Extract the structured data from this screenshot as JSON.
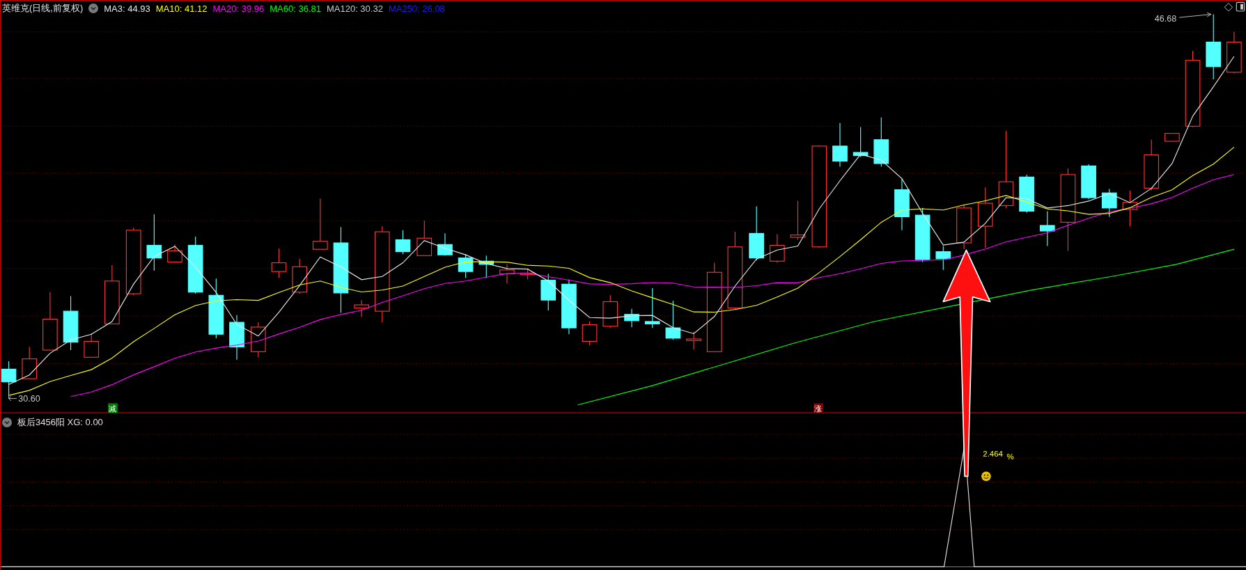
{
  "main_pane": {
    "title": "英维克(日线,前复权)",
    "ma_legend": [
      {
        "label": "MA3: 44.93",
        "color": "#e8e8e8"
      },
      {
        "label": "MA10: 41.12",
        "color": "#ffff00"
      },
      {
        "label": "MA20: 39.96",
        "color": "#ff00ff"
      },
      {
        "label": "MA60: 36.81",
        "color": "#00ff00"
      },
      {
        "label": "MA120: 30.32",
        "color": "#c8c8c8"
      },
      {
        "label": "MA250: 26.08",
        "color": "#1c1cff"
      }
    ],
    "high_label": "46.68",
    "low_label": "30.60",
    "markers": [
      {
        "text": "减",
        "color": "#008000"
      },
      {
        "text": "涨",
        "color": "#800000"
      }
    ]
  },
  "indicator_pane": {
    "title": "板后3456阳 XG: 0.00",
    "value_label": "2.464",
    "unit": "%"
  }
}
